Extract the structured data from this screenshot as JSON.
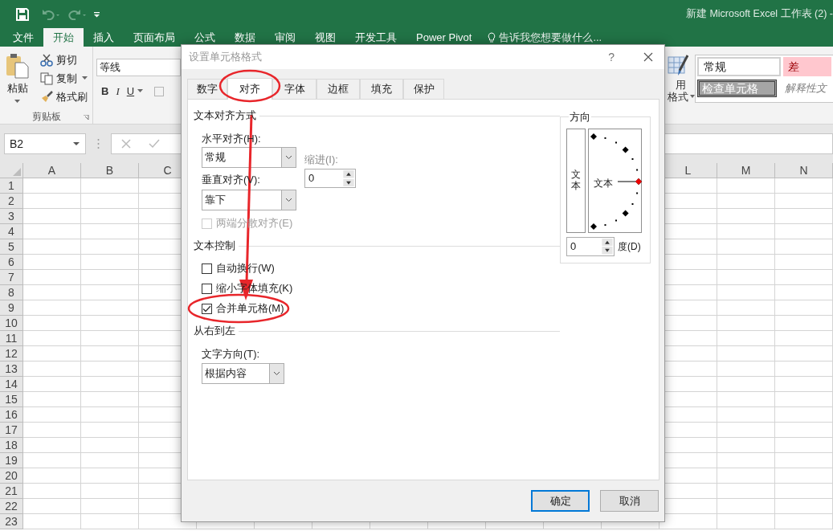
{
  "window": {
    "title": "新建 Microsoft Excel 工作表 (2) -"
  },
  "ribbon_tabs": [
    {
      "label": "文件",
      "selected": false
    },
    {
      "label": "开始",
      "selected": true
    },
    {
      "label": "插入",
      "selected": false
    },
    {
      "label": "页面布局",
      "selected": false
    },
    {
      "label": "公式",
      "selected": false
    },
    {
      "label": "数据",
      "selected": false
    },
    {
      "label": "审阅",
      "selected": false
    },
    {
      "label": "视图",
      "selected": false
    },
    {
      "label": "开发工具",
      "selected": false
    },
    {
      "label": "Power Pivot",
      "selected": false
    }
  ],
  "tell_me": "告诉我您想要做什么...",
  "clipboard": {
    "paste": "粘贴",
    "cut": "剪切",
    "copy": "复制",
    "format_painter": "格式刷",
    "group_label": "剪贴板"
  },
  "font": {
    "name": "等线",
    "format_buttons": [
      "B",
      "I",
      "U"
    ]
  },
  "table_format": {
    "line_1": "用",
    "line_2": "格式"
  },
  "cell_styles": [
    {
      "label": "常规",
      "kind": "normal"
    },
    {
      "label": "差",
      "kind": "bad"
    },
    {
      "label": "检查单元格",
      "kind": "check"
    },
    {
      "label": "解释性文",
      "kind": "explanatory"
    }
  ],
  "name_box": "B2",
  "sheet": {
    "columns_left": [
      "A",
      "B",
      "C"
    ],
    "columns_right": [
      "L",
      "M",
      "N"
    ],
    "rows": [
      "1",
      "2",
      "3",
      "4",
      "5",
      "6",
      "7",
      "8",
      "9",
      "10",
      "11",
      "12",
      "13",
      "14",
      "15",
      "16",
      "17",
      "18",
      "19",
      "20",
      "21",
      "22",
      "23"
    ]
  },
  "dialog": {
    "title": "设置单元格格式",
    "help": "?",
    "tabs": [
      {
        "label": "数字",
        "selected": false
      },
      {
        "label": "对齐",
        "selected": true
      },
      {
        "label": "字体",
        "selected": false
      },
      {
        "label": "边框",
        "selected": false
      },
      {
        "label": "填充",
        "selected": false
      },
      {
        "label": "保护",
        "selected": false
      }
    ],
    "alignment": {
      "title": "文本对齐方式",
      "horizontal_label": "水平对齐(H):",
      "horizontal_value": "常规",
      "vertical_label": "垂直对齐(V):",
      "vertical_value": "靠下",
      "indent_label": "缩进(I):",
      "indent_disabled": true,
      "indent_value": "0",
      "justify": {
        "label": "两端分散对齐(E)",
        "checked": false,
        "disabled": true
      }
    },
    "text_control": {
      "title": "文本控制",
      "options": [
        {
          "label": "自动换行(W)",
          "checked": false
        },
        {
          "label": "缩小字体填充(K)",
          "checked": false
        },
        {
          "label": "合并单元格(M)",
          "checked": true
        }
      ]
    },
    "rtl": {
      "title": "从右到左",
      "direction_label": "文字方向(T):",
      "direction_value": "根据内容"
    },
    "orientation": {
      "title": "方向",
      "vertical_text": "文本",
      "dial_text": "文本",
      "degrees": "0",
      "degrees_label": "度(D)"
    },
    "buttons": [
      {
        "label": "确定",
        "default": true
      },
      {
        "label": "取消",
        "default": false
      }
    ]
  }
}
